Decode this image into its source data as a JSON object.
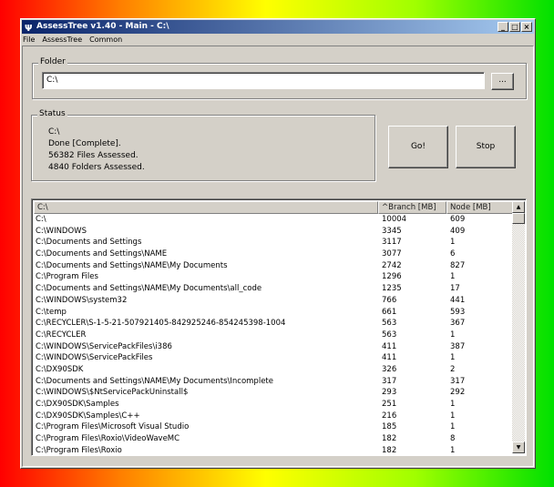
{
  "window": {
    "title": "AssessTree v1.40 - Main - C:\\",
    "minimize": "_",
    "maximize": "□",
    "close": "×"
  },
  "menu": [
    "File",
    "AssessTree",
    "Common"
  ],
  "folder": {
    "label": "Folder",
    "value": "C:\\",
    "browse_label": "..."
  },
  "status": {
    "label": "Status",
    "lines": [
      "C:\\",
      "Done [Complete].",
      "56382 Files Assessed.",
      "4840 Folders Assessed."
    ]
  },
  "buttons": {
    "go": "Go!",
    "stop": "Stop"
  },
  "table": {
    "headers": [
      "C:\\",
      "^Branch [MB]",
      "Node [MB]"
    ],
    "rows": [
      [
        "C:\\",
        "10004",
        "609"
      ],
      [
        "C:\\WINDOWS",
        "3345",
        "409"
      ],
      [
        "C:\\Documents and Settings",
        "3117",
        "1"
      ],
      [
        "C:\\Documents and Settings\\NAME",
        "3077",
        "6"
      ],
      [
        "C:\\Documents and Settings\\NAME\\My Documents",
        "2742",
        "827"
      ],
      [
        "C:\\Program Files",
        "1296",
        "1"
      ],
      [
        "C:\\Documents and Settings\\NAME\\My Documents\\all_code",
        "1235",
        "17"
      ],
      [
        "C:\\WINDOWS\\system32",
        "766",
        "441"
      ],
      [
        "C:\\temp",
        "661",
        "593"
      ],
      [
        "C:\\RECYCLER\\S-1-5-21-507921405-842925246-854245398-1004",
        "563",
        "367"
      ],
      [
        "C:\\RECYCLER",
        "563",
        "1"
      ],
      [
        "C:\\WINDOWS\\ServicePackFiles\\i386",
        "411",
        "387"
      ],
      [
        "C:\\WINDOWS\\ServicePackFiles",
        "411",
        "1"
      ],
      [
        "C:\\DX90SDK",
        "326",
        "2"
      ],
      [
        "C:\\Documents and Settings\\NAME\\My Documents\\Incomplete",
        "317",
        "317"
      ],
      [
        "C:\\WINDOWS\\$NtServicePackUninstall$",
        "293",
        "292"
      ],
      [
        "C:\\DX90SDK\\Samples",
        "251",
        "1"
      ],
      [
        "C:\\DX90SDK\\Samples\\C++",
        "216",
        "1"
      ],
      [
        "C:\\Program Files\\Microsoft Visual Studio",
        "185",
        "1"
      ],
      [
        "C:\\Program Files\\Roxio\\VideoWaveMC",
        "182",
        "8"
      ],
      [
        "C:\\Program Files\\Roxio",
        "182",
        "1"
      ]
    ]
  }
}
